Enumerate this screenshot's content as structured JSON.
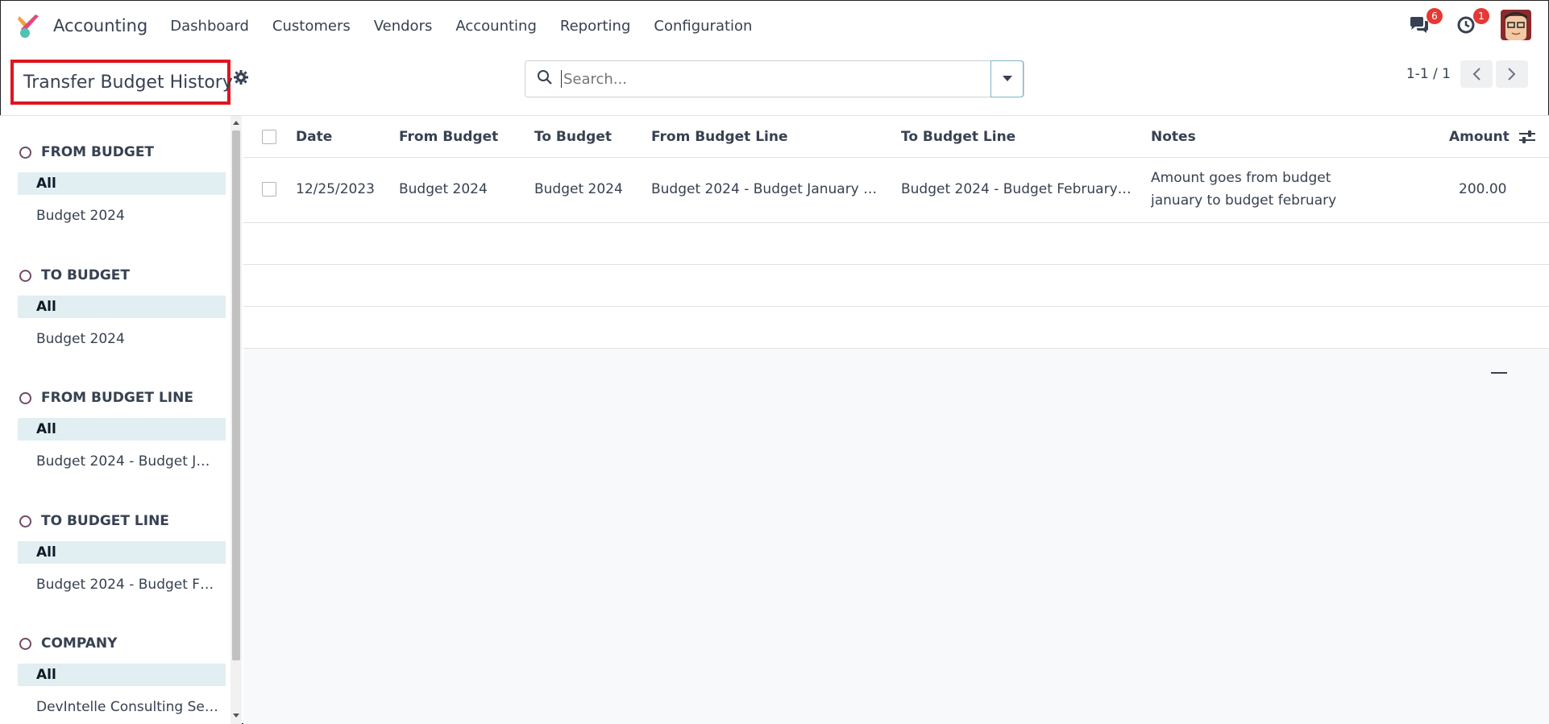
{
  "nav": {
    "app_name": "Accounting",
    "menu": [
      "Dashboard",
      "Customers",
      "Vendors",
      "Accounting",
      "Reporting",
      "Configuration"
    ],
    "messages_count": "6",
    "activities_count": "1"
  },
  "control": {
    "title": "Transfer Budget History",
    "search_placeholder": "Search...",
    "pager": "1-1 / 1"
  },
  "sidebar": {
    "sections": [
      {
        "heading": "FROM BUDGET",
        "active": "All",
        "option": "Budget 2024"
      },
      {
        "heading": "TO BUDGET",
        "active": "All",
        "option": "Budget 2024"
      },
      {
        "heading": "FROM BUDGET LINE",
        "active": "All",
        "option": "Budget 2024 - Budget J…"
      },
      {
        "heading": "TO BUDGET LINE",
        "active": "All",
        "option": "Budget 2024 - Budget F…"
      },
      {
        "heading": "COMPANY",
        "active": "All",
        "option": "DevIntelle Consulting Se…"
      }
    ]
  },
  "table": {
    "headers": {
      "date": "Date",
      "from_budget": "From Budget",
      "to_budget": "To Budget",
      "from_line": "From Budget Line",
      "to_line": "To Budget Line",
      "notes": "Notes",
      "amount": "Amount"
    },
    "rows": [
      {
        "date": "12/25/2023",
        "from_budget": "Budget 2024",
        "to_budget": "Budget 2024",
        "from_line": "Budget 2024 - Budget January …",
        "to_line": "Budget 2024 - Budget February…",
        "notes_line1": "Amount goes from budget",
        "notes_line2": "january to budget february",
        "amount": "200.00"
      }
    ]
  },
  "colors": {
    "highlight_border": "#e0141e",
    "active_filter_bg": "#e1eef2",
    "badge": "#e53935",
    "brand": "#714b67"
  }
}
